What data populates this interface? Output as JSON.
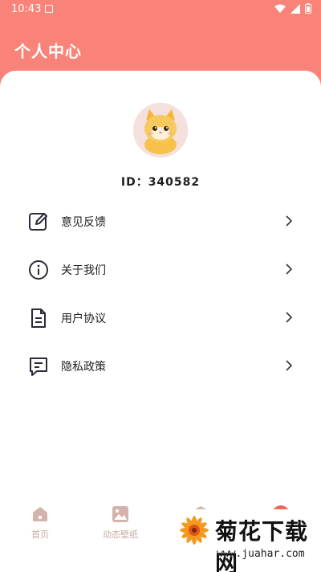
{
  "status_bar": {
    "time": "10:43"
  },
  "header": {
    "title": "个人中心"
  },
  "profile": {
    "id_text": "ID：340582"
  },
  "menu": [
    {
      "label": "意见反馈",
      "icon": "edit-icon"
    },
    {
      "label": "关于我们",
      "icon": "info-icon"
    },
    {
      "label": "用户协议",
      "icon": "document-icon"
    },
    {
      "label": "隐私政策",
      "icon": "message-icon"
    }
  ],
  "tabs": [
    {
      "label": "首页",
      "icon": "home-icon"
    },
    {
      "label": "动态壁纸",
      "icon": "image-icon"
    },
    {
      "label": "",
      "icon": "cube-icon"
    },
    {
      "label": "",
      "icon": "profile-icon"
    }
  ],
  "watermark": {
    "text": "菊花下载网",
    "url": "www.juahar.com"
  },
  "colors": {
    "header": "#f98378",
    "accent": "#f06a5c",
    "tab_inactive": "#c9a9a3"
  }
}
